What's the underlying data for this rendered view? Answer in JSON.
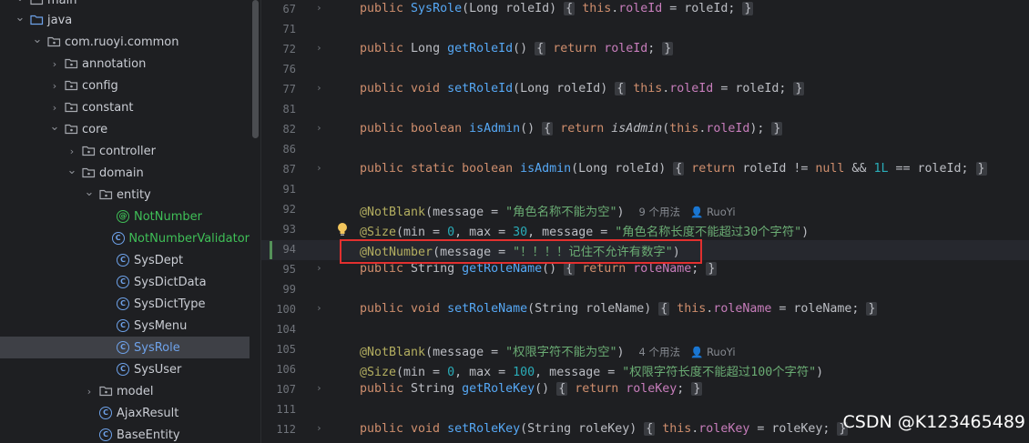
{
  "tree": {
    "items": [
      {
        "label": "main",
        "icon": "folder-icon",
        "chev": "down"
      },
      {
        "label": "java",
        "icon": "source-folder-icon",
        "chev": "down"
      },
      {
        "label": "com.ruoyi.common",
        "icon": "package-icon",
        "chev": "down"
      },
      {
        "label": "annotation",
        "icon": "package-icon",
        "chev": "right"
      },
      {
        "label": "config",
        "icon": "package-icon",
        "chev": "right"
      },
      {
        "label": "constant",
        "icon": "package-icon",
        "chev": "right"
      },
      {
        "label": "core",
        "icon": "package-icon",
        "chev": "down"
      },
      {
        "label": "controller",
        "icon": "package-icon",
        "chev": "right"
      },
      {
        "label": "domain",
        "icon": "package-icon",
        "chev": "down"
      },
      {
        "label": "entity",
        "icon": "package-icon",
        "chev": "down"
      },
      {
        "label": "NotNumber",
        "icon": "annotation-icon",
        "chev": "none",
        "style": "green"
      },
      {
        "label": "NotNumberValidator",
        "icon": "class-icon",
        "chev": "none",
        "style": "green"
      },
      {
        "label": "SysDept",
        "icon": "class-icon",
        "chev": "none"
      },
      {
        "label": "SysDictData",
        "icon": "class-icon",
        "chev": "none"
      },
      {
        "label": "SysDictType",
        "icon": "class-icon",
        "chev": "none"
      },
      {
        "label": "SysMenu",
        "icon": "class-icon",
        "chev": "none"
      },
      {
        "label": "SysRole",
        "icon": "class-icon",
        "chev": "none",
        "style": "selected"
      },
      {
        "label": "SysUser",
        "icon": "class-icon",
        "chev": "none"
      },
      {
        "label": "model",
        "icon": "package-icon",
        "chev": "right"
      },
      {
        "label": "AjaxResult",
        "icon": "class-icon",
        "chev": "none"
      },
      {
        "label": "BaseEntity",
        "icon": "class-icon",
        "chev": "none"
      }
    ]
  },
  "editor": {
    "lines": [
      {
        "n": "67",
        "fold": true,
        "tokens": [
          [
            "kw",
            "public "
          ],
          [
            "fn",
            "SysRole"
          ],
          [
            "",
            "(Long roleId) "
          ],
          [
            "brace",
            "{"
          ],
          [
            "",
            ""
          ],
          [
            "kw",
            " this"
          ],
          [
            "",
            "."
          ],
          [
            "fld",
            "roleId"
          ],
          [
            "",
            " = roleId; "
          ],
          [
            "brace",
            "}"
          ]
        ]
      },
      {
        "n": "71",
        "fold": false,
        "tokens": []
      },
      {
        "n": "72",
        "fold": true,
        "tokens": [
          [
            "kw",
            "public "
          ],
          [
            "",
            "Long "
          ],
          [
            "fn",
            "getRoleId"
          ],
          [
            "",
            "() "
          ],
          [
            "brace",
            "{"
          ],
          [
            "kw",
            " return "
          ],
          [
            "fld",
            "roleId"
          ],
          [
            "",
            "; "
          ],
          [
            "brace",
            "}"
          ]
        ]
      },
      {
        "n": "76",
        "fold": false,
        "tokens": []
      },
      {
        "n": "77",
        "fold": true,
        "tokens": [
          [
            "kw",
            "public void "
          ],
          [
            "fn",
            "setRoleId"
          ],
          [
            "",
            "(Long roleId) "
          ],
          [
            "brace",
            "{"
          ],
          [
            "kw",
            " this"
          ],
          [
            "",
            "."
          ],
          [
            "fld",
            "roleId"
          ],
          [
            "",
            " = roleId; "
          ],
          [
            "brace",
            "}"
          ]
        ]
      },
      {
        "n": "81",
        "fold": false,
        "tokens": []
      },
      {
        "n": "82",
        "fold": true,
        "tokens": [
          [
            "kw",
            "public boolean "
          ],
          [
            "fn",
            "isAdmin"
          ],
          [
            "",
            "() "
          ],
          [
            "brace",
            "{"
          ],
          [
            "kw",
            " return "
          ],
          [
            "it",
            "isAdmin"
          ],
          [
            "",
            "("
          ],
          [
            "kw",
            "this"
          ],
          [
            "",
            "."
          ],
          [
            "fld",
            "roleId"
          ],
          [
            "",
            "); "
          ],
          [
            "brace",
            "}"
          ]
        ]
      },
      {
        "n": "86",
        "fold": false,
        "tokens": []
      },
      {
        "n": "87",
        "fold": true,
        "tokens": [
          [
            "kw",
            "public static boolean "
          ],
          [
            "fn",
            "isAdmin"
          ],
          [
            "",
            "(Long roleId) "
          ],
          [
            "brace",
            "{"
          ],
          [
            "kw",
            " return "
          ],
          [
            "",
            "roleId != "
          ],
          [
            "kw",
            "null"
          ],
          [
            "",
            " && "
          ],
          [
            "num",
            "1L"
          ],
          [
            "",
            " == roleId; "
          ],
          [
            "brace",
            "}"
          ]
        ]
      },
      {
        "n": "91",
        "fold": false,
        "tokens": []
      },
      {
        "n": "92",
        "fold": false,
        "tokens": [
          [
            "ann",
            "@NotBlank"
          ],
          [
            "",
            "(message = "
          ],
          [
            "str",
            "\"角色名称不能为空\""
          ],
          [
            "",
            ")  "
          ],
          [
            "hint",
            "9 个用法   👤 RuoYi"
          ]
        ]
      },
      {
        "n": "93",
        "fold": false,
        "tokens": [
          [
            "ann",
            "@Size"
          ],
          [
            "",
            "(min = "
          ],
          [
            "num",
            "0"
          ],
          [
            "",
            ", max = "
          ],
          [
            "num",
            "30"
          ],
          [
            "",
            ", message = "
          ],
          [
            "str",
            "\"角色名称长度不能超过30个字符\""
          ],
          [
            "",
            ")"
          ]
        ]
      },
      {
        "n": "94",
        "fold": false,
        "tokens": [
          [
            "ann",
            "@NotNumber"
          ],
          [
            "",
            "(message = "
          ],
          [
            "str",
            "\"！！！！记住不允许有数字\""
          ],
          [
            "",
            ")"
          ]
        ]
      },
      {
        "n": "95",
        "fold": true,
        "tokens": [
          [
            "kw",
            "public "
          ],
          [
            "",
            "String "
          ],
          [
            "fn",
            "getRoleName"
          ],
          [
            "",
            "() "
          ],
          [
            "brace",
            "{"
          ],
          [
            "kw",
            " return "
          ],
          [
            "fld",
            "roleName"
          ],
          [
            "",
            "; "
          ],
          [
            "brace",
            "}"
          ]
        ]
      },
      {
        "n": "99",
        "fold": false,
        "tokens": []
      },
      {
        "n": "100",
        "fold": true,
        "tokens": [
          [
            "kw",
            "public void "
          ],
          [
            "fn",
            "setRoleName"
          ],
          [
            "",
            "(String roleName) "
          ],
          [
            "brace",
            "{"
          ],
          [
            "kw",
            " this"
          ],
          [
            "",
            "."
          ],
          [
            "fld",
            "roleName"
          ],
          [
            "",
            " = roleName; "
          ],
          [
            "brace",
            "}"
          ]
        ]
      },
      {
        "n": "104",
        "fold": false,
        "tokens": []
      },
      {
        "n": "105",
        "fold": false,
        "tokens": [
          [
            "ann",
            "@NotBlank"
          ],
          [
            "",
            "(message = "
          ],
          [
            "str",
            "\"权限字符不能为空\""
          ],
          [
            "",
            ")  "
          ],
          [
            "hint",
            "4 个用法   👤 RuoYi"
          ]
        ]
      },
      {
        "n": "106",
        "fold": false,
        "tokens": [
          [
            "ann",
            "@Size"
          ],
          [
            "",
            "(min = "
          ],
          [
            "num",
            "0"
          ],
          [
            "",
            ", max = "
          ],
          [
            "num",
            "100"
          ],
          [
            "",
            ", message = "
          ],
          [
            "str",
            "\"权限字符长度不能超过100个字符\""
          ],
          [
            "",
            ")"
          ]
        ]
      },
      {
        "n": "107",
        "fold": true,
        "tokens": [
          [
            "kw",
            "public "
          ],
          [
            "",
            "String "
          ],
          [
            "fn",
            "getRoleKey"
          ],
          [
            "",
            "() "
          ],
          [
            "brace",
            "{"
          ],
          [
            "kw",
            " return "
          ],
          [
            "fld",
            "roleKey"
          ],
          [
            "",
            "; "
          ],
          [
            "brace",
            "}"
          ]
        ]
      },
      {
        "n": "111",
        "fold": false,
        "tokens": []
      },
      {
        "n": "112",
        "fold": true,
        "tokens": [
          [
            "kw",
            "public void "
          ],
          [
            "fn",
            "setRoleKey"
          ],
          [
            "",
            "(String roleKey) "
          ],
          [
            "brace",
            "{"
          ],
          [
            "kw",
            " this"
          ],
          [
            "",
            "."
          ],
          [
            "fld",
            "roleKey"
          ],
          [
            "",
            " = roleKey; "
          ],
          [
            "brace",
            "}"
          ]
        ]
      }
    ],
    "current_line": "94",
    "changed_line": "94",
    "bulb_line": "93"
  },
  "watermark": "CSDN @K123465489",
  "colors": {
    "keyword": "#cf8e6d",
    "function": "#56a8f5",
    "field": "#c77dbb",
    "annotation": "#b3ae60",
    "string": "#6aab73",
    "number": "#2aacb8",
    "highlight_box": "#e2302f"
  }
}
